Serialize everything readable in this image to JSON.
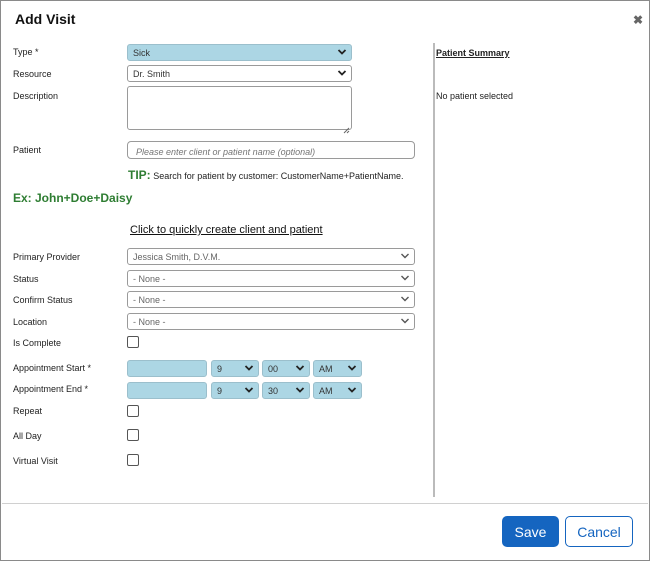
{
  "dialog": {
    "title": "Add Visit",
    "close_icon": "close-icon"
  },
  "form": {
    "type": {
      "label": "Type *",
      "value": "Sick"
    },
    "resource": {
      "label": "Resource",
      "value": "Dr. Smith"
    },
    "description": {
      "label": "Description",
      "value": ""
    },
    "patient": {
      "label": "Patient",
      "placeholder": "Please enter client or patient name (optional)"
    },
    "tip": {
      "prefix": "TIP:",
      "text": "Search for patient by customer: CustomerName+PatientName."
    },
    "example": "Ex: John+Doe+Daisy",
    "quick_create": "Click to quickly create client and patient",
    "primary_provider": {
      "label": "Primary Provider",
      "value": "Jessica Smith, D.V.M."
    },
    "status": {
      "label": "Status",
      "value": "- None -"
    },
    "confirm_status": {
      "label": "Confirm Status",
      "value": "- None -"
    },
    "location": {
      "label": "Location",
      "value": "- None -"
    },
    "is_complete": {
      "label": "Is Complete",
      "checked": false
    },
    "appointment_start": {
      "label": "Appointment Start *",
      "date": "",
      "hour": "9",
      "minute": "00",
      "ampm": "AM"
    },
    "appointment_end": {
      "label": "Appointment End *",
      "date": "",
      "hour": "9",
      "minute": "30",
      "ampm": "AM"
    },
    "repeat": {
      "label": "Repeat",
      "checked": false
    },
    "all_day": {
      "label": "All Day",
      "checked": false
    },
    "virtual_visit": {
      "label": "Virtual Visit",
      "checked": false
    }
  },
  "patient_summary": {
    "title": "Patient Summary",
    "empty_text": "No patient selected"
  },
  "buttons": {
    "save": "Save",
    "cancel": "Cancel"
  },
  "colors": {
    "primary": "#1565c0",
    "field_highlight": "#acd6e4",
    "tip_green": "#2e7d32"
  }
}
